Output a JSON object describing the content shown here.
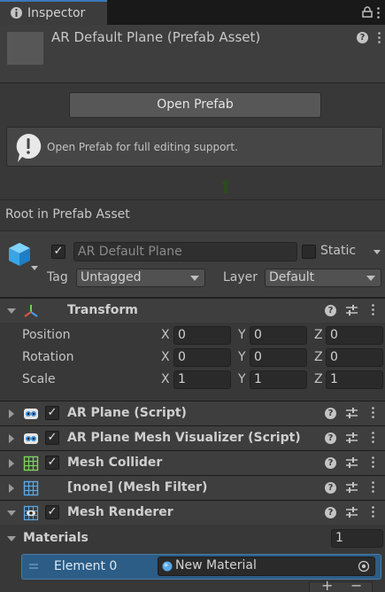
{
  "tab": {
    "title": "Inspector"
  },
  "header": {
    "title": "AR Default Plane (Prefab Asset)"
  },
  "prefab": {
    "open_button": "Open Prefab",
    "help_text": "Open Prefab for full editing support.",
    "root_label": "Root in Prefab Asset"
  },
  "gameobject": {
    "name": "AR Default Plane",
    "static_label": "Static",
    "tag_label": "Tag",
    "tag_value": "Untagged",
    "layer_label": "Layer",
    "layer_value": "Default"
  },
  "transform": {
    "title": "Transform",
    "rows": [
      {
        "label": "Position",
        "x": "0",
        "y": "0",
        "z": "0"
      },
      {
        "label": "Rotation",
        "x": "0",
        "y": "0",
        "z": "0"
      },
      {
        "label": "Scale",
        "x": "1",
        "y": "1",
        "z": "1"
      }
    ],
    "axis_x": "X",
    "axis_y": "Y",
    "axis_z": "Z"
  },
  "components": [
    {
      "title": "AR Plane (Script)",
      "icon": "script-icon"
    },
    {
      "title": "AR Plane Mesh Visualizer (Script)",
      "icon": "script-icon"
    },
    {
      "title": "Mesh Collider",
      "icon": "mesh-collider-icon"
    },
    {
      "title": "[none] (Mesh Filter)",
      "icon": "mesh-filter-icon"
    },
    {
      "title": "Mesh Renderer",
      "icon": "mesh-renderer-icon"
    }
  ],
  "materials": {
    "label": "Materials",
    "count": "1",
    "element_label": "Element 0",
    "element_value": "New Material"
  },
  "colors": {
    "accent": "#3a79bb",
    "selection": "#2c5d87",
    "background": "#383838",
    "header": "#3e3e3e"
  }
}
